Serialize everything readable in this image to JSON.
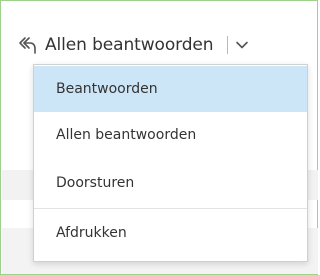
{
  "reply_split_button": {
    "label": "Allen beantwoorden",
    "icon": "reply-all-icon",
    "dropdown_icon": "chevron-down-icon"
  },
  "menu": {
    "items": [
      {
        "label": "Beantwoorden",
        "selected": true
      },
      {
        "label": "Allen beantwoorden",
        "selected": false
      },
      {
        "label": "Doorsturen",
        "selected": false
      },
      {
        "label": "Afdrukken",
        "selected": false
      }
    ]
  },
  "colors": {
    "frame_border": "#9ed18a",
    "selected_bg": "#cde6f7",
    "text": "#333333"
  }
}
